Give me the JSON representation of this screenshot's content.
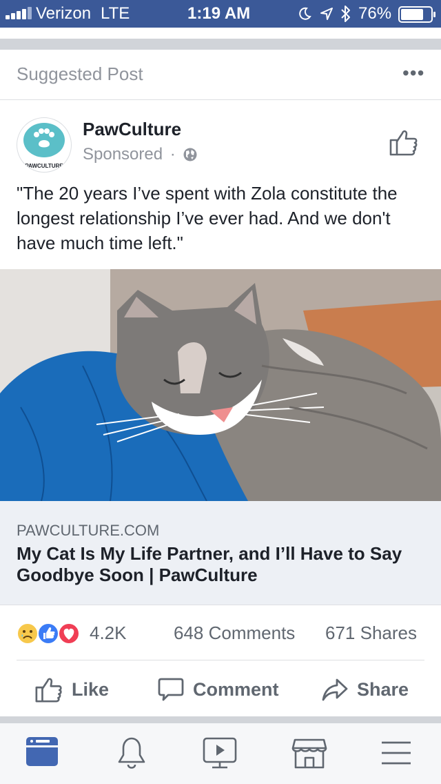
{
  "status_bar": {
    "carrier": "Verizon",
    "network": "LTE",
    "time": "1:19 AM",
    "battery": "76%",
    "battery_level": 0.76,
    "icons": [
      "signal-bars-icon",
      "moon-icon",
      "location-arrow-icon",
      "bluetooth-icon",
      "battery-icon"
    ]
  },
  "feed": {
    "suggested_label": "Suggested Post",
    "more_label": "•••"
  },
  "post": {
    "author": "PawCulture",
    "avatar_text": "PAWCULTURE",
    "sponsored_label": "Sponsored",
    "separator": "·",
    "text": "\"The 20 years I’ve spent with Zola constitute the longest relationship I’ve ever had. And we don't have much time left.\"",
    "link": {
      "domain": "PAWCULTURE.COM",
      "headline": "My Cat Is My Life Partner, and I’ll Have to Say Goodbye Soon | PawCulture"
    },
    "stats": {
      "reaction_count": "4.2K",
      "comments": "648 Comments",
      "shares": "671 Shares",
      "reaction_icons": [
        "sad-reaction-icon",
        "like-reaction-icon",
        "love-reaction-icon"
      ]
    },
    "actions": {
      "like": "Like",
      "comment": "Comment",
      "share": "Share"
    }
  },
  "tab_bar": {
    "tabs": [
      "news-feed-icon",
      "notifications-icon",
      "watch-icon",
      "marketplace-icon",
      "menu-icon"
    ]
  },
  "colors": {
    "brand": "#3b5998",
    "active_tab": "#4267b2",
    "muted_text": "#90949c",
    "link_box": "#edf0f5",
    "avatar_teal": "#5bbfc8"
  }
}
